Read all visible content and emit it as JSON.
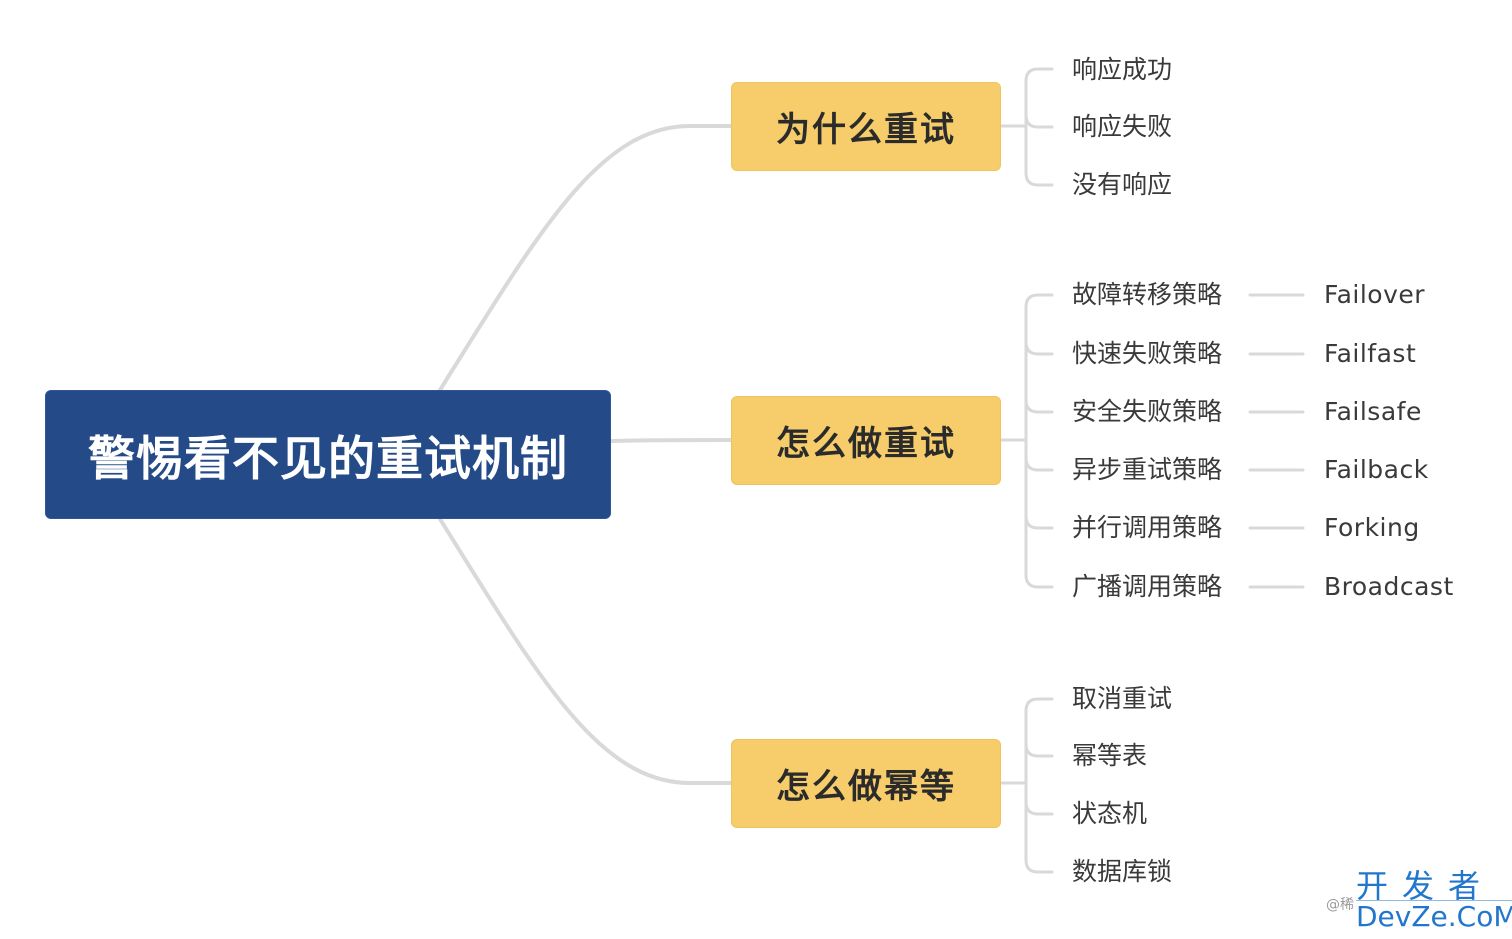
{
  "root": {
    "label": "警惕看不见的重试机制",
    "color": "#244a87"
  },
  "branches": [
    {
      "label": "为什么重试",
      "children": [
        {
          "label": "响应成功"
        },
        {
          "label": "响应失败"
        },
        {
          "label": "没有响应"
        }
      ]
    },
    {
      "label": "怎么做重试",
      "children": [
        {
          "label": "故障转移策略",
          "sub": "Failover"
        },
        {
          "label": "快速失败策略",
          "sub": "Failfast"
        },
        {
          "label": "安全失败策略",
          "sub": "Failsafe"
        },
        {
          "label": "异步重试策略",
          "sub": "Failback"
        },
        {
          "label": "并行调用策略",
          "sub": "Forking"
        },
        {
          "label": "广播调用策略",
          "sub": "Broadcast"
        }
      ]
    },
    {
      "label": "怎么做幂等",
      "children": [
        {
          "label": "取消重试"
        },
        {
          "label": "幂等表"
        },
        {
          "label": "状态机"
        },
        {
          "label": "数据库锁"
        }
      ]
    }
  ],
  "branch_color": "#f6cd6a",
  "connector_color": "#d9d9d9",
  "watermark": {
    "handle": "@稀",
    "site_cn": "开发者",
    "site_en": "DevZe.CoM"
  }
}
